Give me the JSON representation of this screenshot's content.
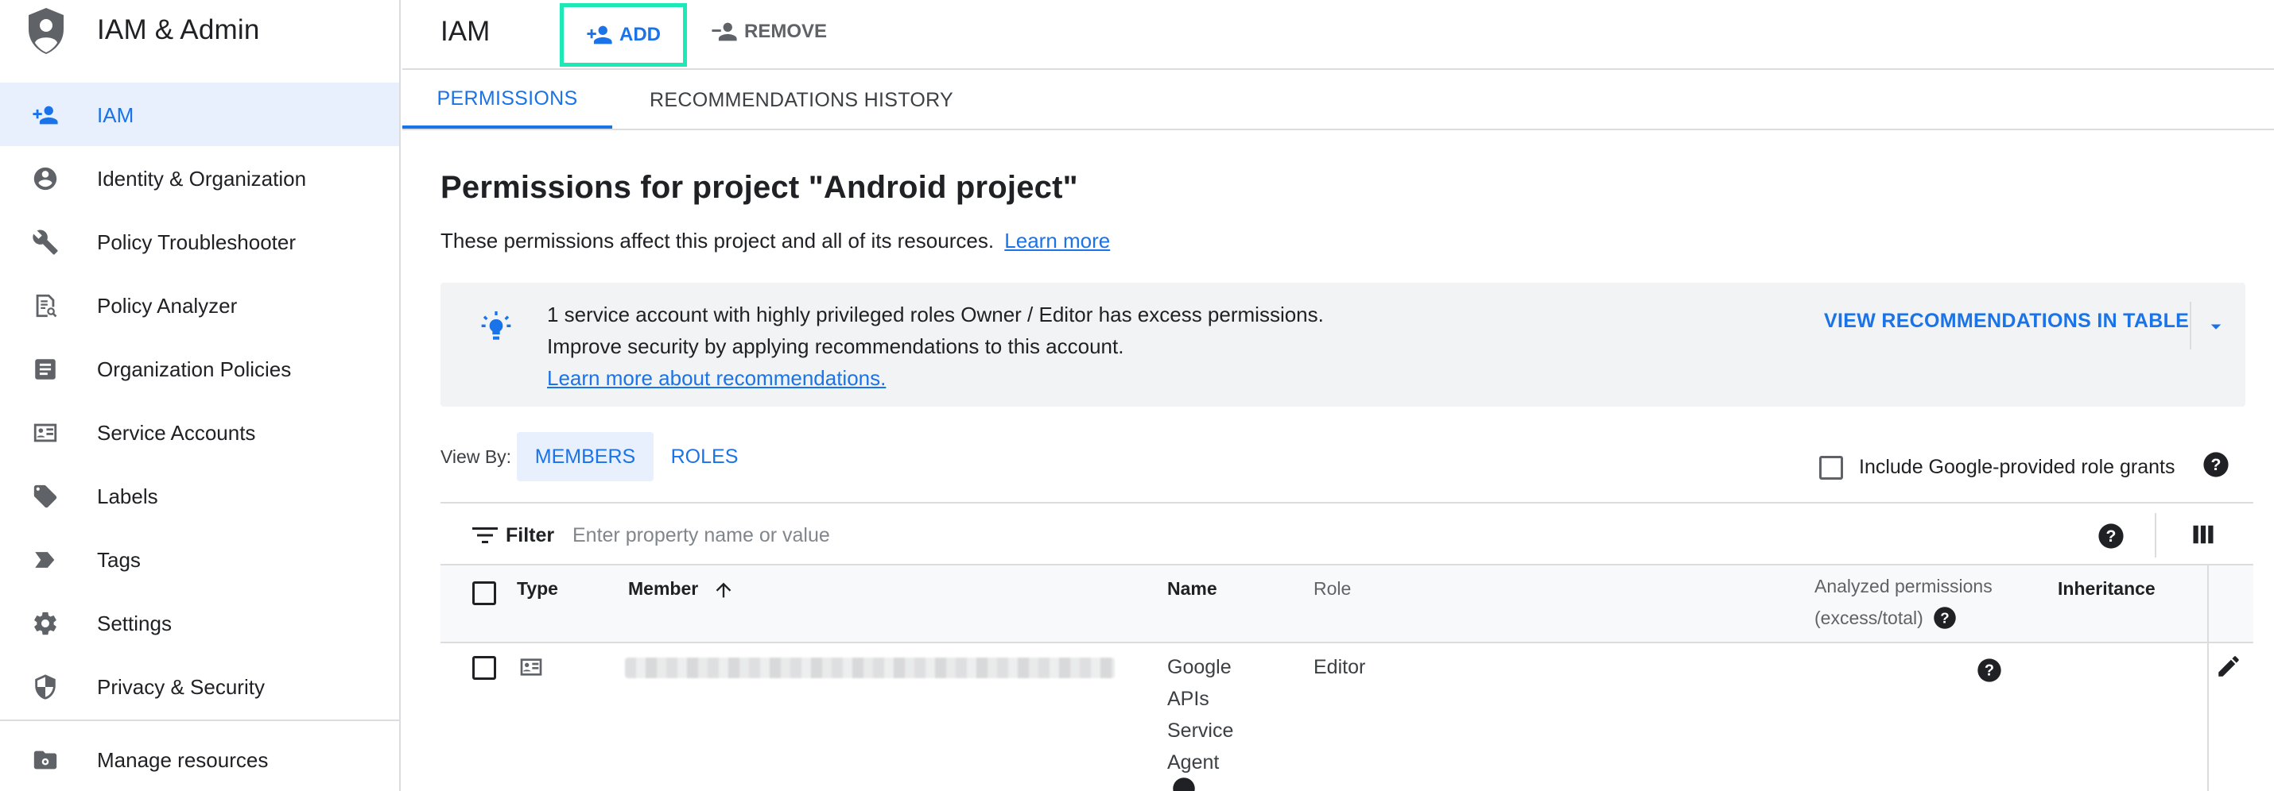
{
  "app": {
    "title": "IAM & Admin"
  },
  "sidebar": {
    "items": [
      {
        "label": "IAM",
        "icon": "person-add-icon",
        "active": true
      },
      {
        "label": "Identity & Organization",
        "icon": "account-circle-icon"
      },
      {
        "label": "Policy Troubleshooter",
        "icon": "wrench-icon"
      },
      {
        "label": "Policy Analyzer",
        "icon": "document-search-icon"
      },
      {
        "label": "Organization Policies",
        "icon": "list-document-icon"
      },
      {
        "label": "Service Accounts",
        "icon": "service-account-icon"
      },
      {
        "label": "Labels",
        "icon": "label-icon"
      },
      {
        "label": "Tags",
        "icon": "tag-icon"
      },
      {
        "label": "Settings",
        "icon": "gear-icon"
      },
      {
        "label": "Privacy & Security",
        "icon": "shield-icon"
      },
      {
        "label": "Manage resources",
        "icon": "folder-settings-icon"
      }
    ]
  },
  "header": {
    "title": "IAM",
    "add_label": "ADD",
    "remove_label": "REMOVE"
  },
  "tabs": [
    {
      "label": "PERMISSIONS",
      "active": true
    },
    {
      "label": "RECOMMENDATIONS HISTORY"
    }
  ],
  "main": {
    "title": "Permissions for project \"Android project\"",
    "description": "These permissions affect this project and all of its resources.",
    "learn_more": "Learn more",
    "recommendation": {
      "line1": "1 service account with highly privileged roles Owner / Editor has excess permissions.",
      "line2": "Improve security by applying recommendations to this account.",
      "link": "Learn more about recommendations.",
      "button": "VIEW RECOMMENDATIONS IN TABLE"
    },
    "view_by": {
      "label": "View By:",
      "members": "MEMBERS",
      "roles": "ROLES"
    },
    "include_google_grants": "Include Google-provided role grants"
  },
  "table": {
    "filter_label": "Filter",
    "filter_placeholder": "Enter property name or value",
    "columns": {
      "type": "Type",
      "member": "Member",
      "name": "Name",
      "role": "Role",
      "analyzed_line1": "Analyzed permissions",
      "analyzed_line2": "(excess/total)",
      "inheritance": "Inheritance"
    },
    "rows": [
      {
        "name_lines": [
          "Google",
          "APIs",
          "Service",
          "Agent"
        ],
        "role": "Editor"
      }
    ]
  },
  "colors": {
    "accent": "#1a73e8",
    "highlight": "#1de9b6",
    "active_bg": "#e8f0fe"
  }
}
